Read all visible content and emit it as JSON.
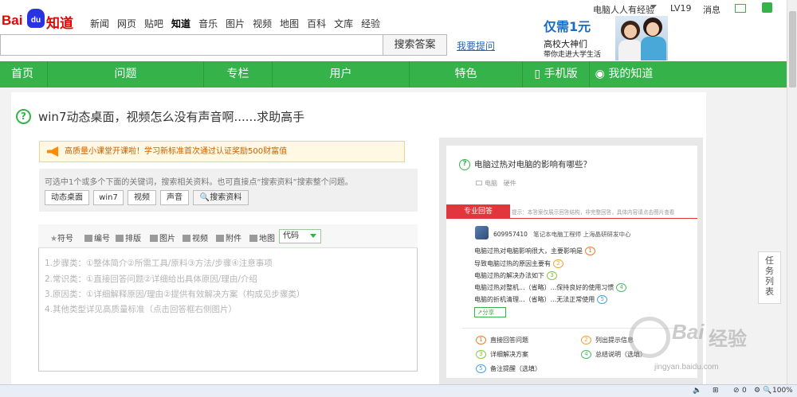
{
  "header": {
    "logo": {
      "bai": "Bai",
      "du": "du",
      "zhidao": "知道"
    },
    "nav": [
      "新闻",
      "网页",
      "贴吧",
      "知道",
      "音乐",
      "图片",
      "视频",
      "地图",
      "百科",
      "文库",
      "经验"
    ],
    "active_nav": "知道",
    "username": "电脑人人有经验",
    "level": "LV19",
    "messages": "消息",
    "search_placeholder": "",
    "search_button": "搜索答案",
    "ask_link": "我要提问",
    "promo": {
      "line1": "仅需1元",
      "line2": "高校大神们",
      "line3": "带你走进大学生活"
    }
  },
  "greenbar": {
    "items": [
      "首页",
      "问题",
      "专栏",
      "用户",
      "特色"
    ],
    "mobile": "手机版",
    "my": "我的知道"
  },
  "question": {
    "title": "win7动态桌面，视频怎么没有声音啊......求助高手"
  },
  "notice": "高质量小课堂开课啦！学习新标准首次通过认证奖励500财富值",
  "keywords": {
    "hint": "可选中1个或多个下面的关键词，搜索相关资料。也可直接点“搜索资料”搜索整个问题。",
    "tags": [
      "动态桌面",
      "win7",
      "视频",
      "声音"
    ],
    "search": "搜索资料"
  },
  "editor": {
    "toolbar": [
      "符号",
      "编号",
      "排版",
      "图片",
      "视频",
      "附件",
      "地图"
    ],
    "code_select": "代码",
    "placeholder": [
      "1.步骤类：①整体简介②所需工具/原料③方法/步骤④注意事项",
      "2.常识类：①直接回答问题②详细给出具体原因/理由/介绍",
      "3.原因类：①详细解释原因/理由②提供有效解决方案（构成见步骤类）",
      "4.其他类型详见高质量标准（点击回答框右侧图片）"
    ]
  },
  "sample": {
    "question": "电脑过热对电脑的影响有哪些？",
    "tags": [
      "电脑",
      "硬件"
    ],
    "badge": "专业回答",
    "tip": "提示：本答案仅展示回答结构，非完整回答，具体内容请点击图片查看",
    "user_id": "609957410",
    "user_desc": "笔记本电脑工程师  上海晶研研发中心",
    "steps": [
      "电脑过热对电脑影响很大，主要影响是",
      "导致电脑过热的原因主要有",
      "电脑过热的解决办法如下",
      "电脑过热对整机...（省略）...保持良好的使用习惯",
      "电脑的折机清理...（省略）...无法正常使用"
    ],
    "share": "分享",
    "legend": [
      "直接回答问题",
      "列出提示信息",
      "详细解决方案",
      "总结说明（选填）",
      "备注提醒（选填）"
    ],
    "colors": {
      "c1": "#f07a2a",
      "c2": "#f2a33a",
      "c3": "#8cc63f",
      "c4": "#4db86b",
      "c5": "#4aa3df"
    }
  },
  "sidebar": {
    "label": "任务列表"
  },
  "watermark": {
    "brand": "Bai",
    "cn": "经验",
    "url": "jingyan.baidu.com"
  },
  "statusbar": {
    "zoom": "100%",
    "count": "0"
  }
}
